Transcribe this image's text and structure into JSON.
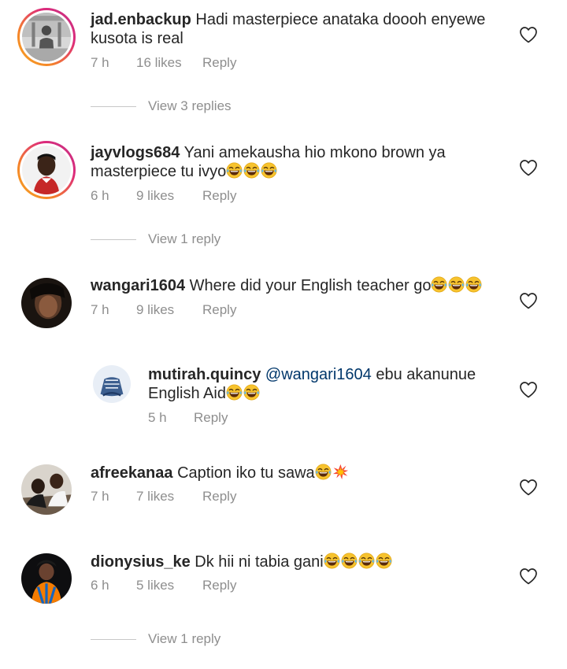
{
  "comments": [
    {
      "username": "jad.enbackup",
      "text": "Hadi masterpiece anataka doooh enyewe",
      "text2": "kusota is real",
      "time": "7 h",
      "likes": "16 likes",
      "reply_label": "Reply",
      "view_replies": "View 3 replies"
    },
    {
      "username": "jayvlogs684",
      "text": "Yani amekausha hio mkono brown ya",
      "text2": "masterpiece tu ivyo",
      "emojis": "😂😂😂",
      "time": "6 h",
      "likes": "9 likes",
      "reply_label": "Reply",
      "view_replies": "View 1 reply"
    },
    {
      "username": "wangari1604",
      "text": "Where did your English teacher go",
      "emojis": "😂😂😂",
      "time": "7 h",
      "likes": "9 likes",
      "reply_label": "Reply"
    },
    {
      "username": "mutirah.quincy",
      "mention": "@wangari1604",
      "text": "ebu akanunue",
      "text2": "English Aid",
      "emojis": "😂😂",
      "time": "5 h",
      "reply_label": "Reply"
    },
    {
      "username": "afreekanaa",
      "text": "Caption iko tu sawa",
      "emojis": "😂💥",
      "time": "7 h",
      "likes": "7 likes",
      "reply_label": "Reply"
    },
    {
      "username": "dionysius_ke",
      "text": "Dk hii ni tabia gani",
      "emojis": "😂😂😂😂",
      "time": "6 h",
      "likes": "5 likes",
      "reply_label": "Reply",
      "view_replies": "View 1 reply"
    }
  ],
  "icons": {
    "like": "heart-outline-icon",
    "emoji_laugh": "face-with-tears-of-joy-icon",
    "emoji_collision": "collision-icon"
  },
  "colors": {
    "text": "#262626",
    "meta": "#8e8e8e",
    "mention": "#00376b",
    "story_ring_start": "#f5a623",
    "story_ring_end": "#c13584"
  }
}
